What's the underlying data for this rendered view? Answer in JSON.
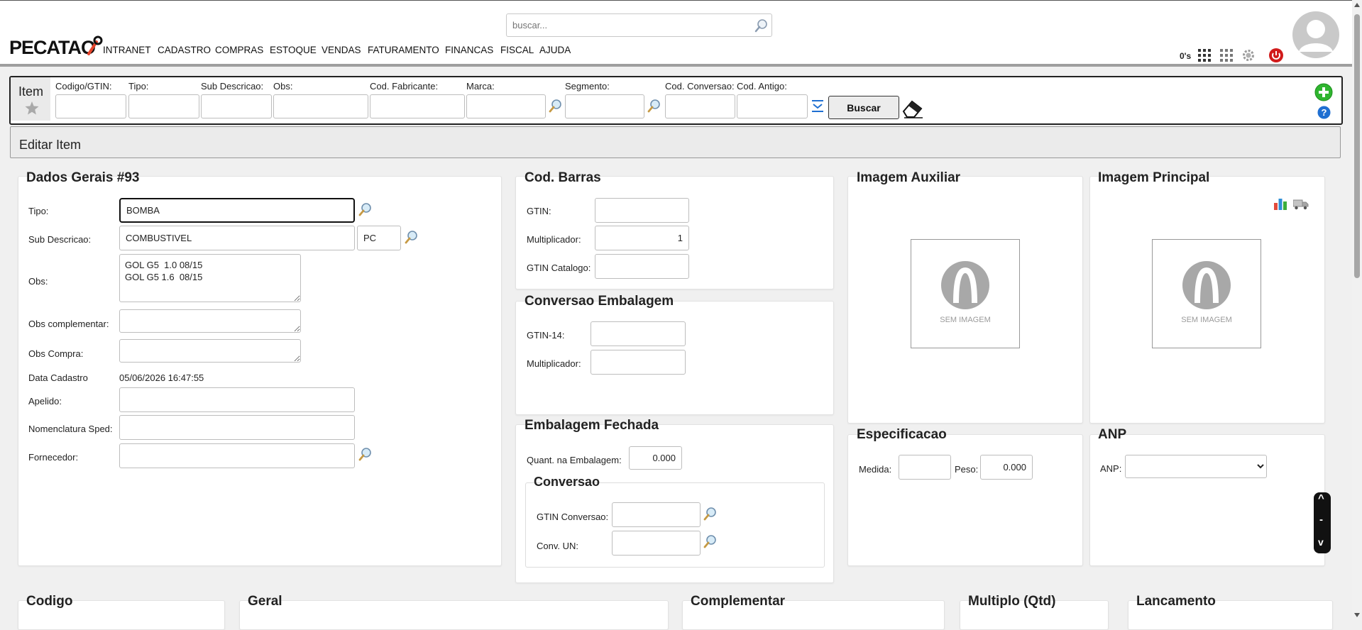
{
  "header": {
    "logo": "PECATAO",
    "search_placeholder": "buscar...",
    "nav": [
      "INTRANET",
      "CADASTRO",
      "COMPRAS",
      "ESTOQUE",
      "VENDAS",
      "FATURAMENTO",
      "FINANCAS",
      "FISCAL",
      "AJUDA"
    ],
    "counter": "0's"
  },
  "filter": {
    "title": "Item",
    "labels": [
      "Codigo/GTIN:",
      "Tipo:",
      "Sub Descricao:",
      "Obs:",
      "Cod. Fabricante:",
      "Marca:",
      "Segmento:",
      "Cod. Conversao:",
      "Cod. Antigo:"
    ],
    "buscar": "Buscar"
  },
  "section_title": "Editar Item",
  "dados": {
    "title": "Dados Gerais #93",
    "tipo_label": "Tipo:",
    "tipo_value": "BOMBA",
    "sub_label": "Sub Descricao:",
    "sub_value": "COMBUSTIVEL",
    "unit_value": "PC",
    "obs_label": "Obs:",
    "obs_value": "GOL G5  1.0 08/15\nGOL G5 1.6  08/15",
    "obs_comp_label": "Obs complementar:",
    "obs_compra_label": "Obs Compra:",
    "data_label": "Data Cadastro",
    "data_value": "05/06/2026 16:47:55",
    "apelido_label": "Apelido:",
    "nomenclatura_label": "Nomenclatura Sped:",
    "fornecedor_label": "Fornecedor:"
  },
  "barras": {
    "title": "Cod. Barras",
    "gtin_label": "GTIN:",
    "mult_label": "Multiplicador:",
    "mult_value": "1",
    "gtin_cat_label": "GTIN Catalogo:"
  },
  "conv_emb": {
    "title": "Conversao Embalagem",
    "gtin14_label": "GTIN-14:",
    "mult_label": "Multiplicador:"
  },
  "emb_fechada": {
    "title": "Embalagem Fechada",
    "quant_label": "Quant. na Embalagem:",
    "quant_value": "0.000",
    "conv_title": "Conversao",
    "gtin_conv_label": "GTIN Conversao:",
    "conv_un_label": "Conv. UN:"
  },
  "img_aux": {
    "title": "Imagem Auxiliar",
    "no_image": "SEM IMAGEM"
  },
  "img_main": {
    "title": "Imagem Principal",
    "no_image": "SEM IMAGEM"
  },
  "espec": {
    "title": "Especificacao",
    "medida_label": "Medida:",
    "peso_label": "Peso:",
    "peso_value": "0.000"
  },
  "anp": {
    "title": "ANP",
    "anp_label": "ANP:"
  },
  "bottom": {
    "codigo": "Codigo",
    "geral": "Geral",
    "complementar": "Complementar",
    "multiplo": "Multiplo (Qtd)",
    "lancamento": "Lancamento"
  },
  "colors": {
    "accent_red": "#e8452c",
    "power_red": "#d11b1b",
    "add_green": "#2fb52f",
    "help_blue": "#1f6fd1"
  }
}
